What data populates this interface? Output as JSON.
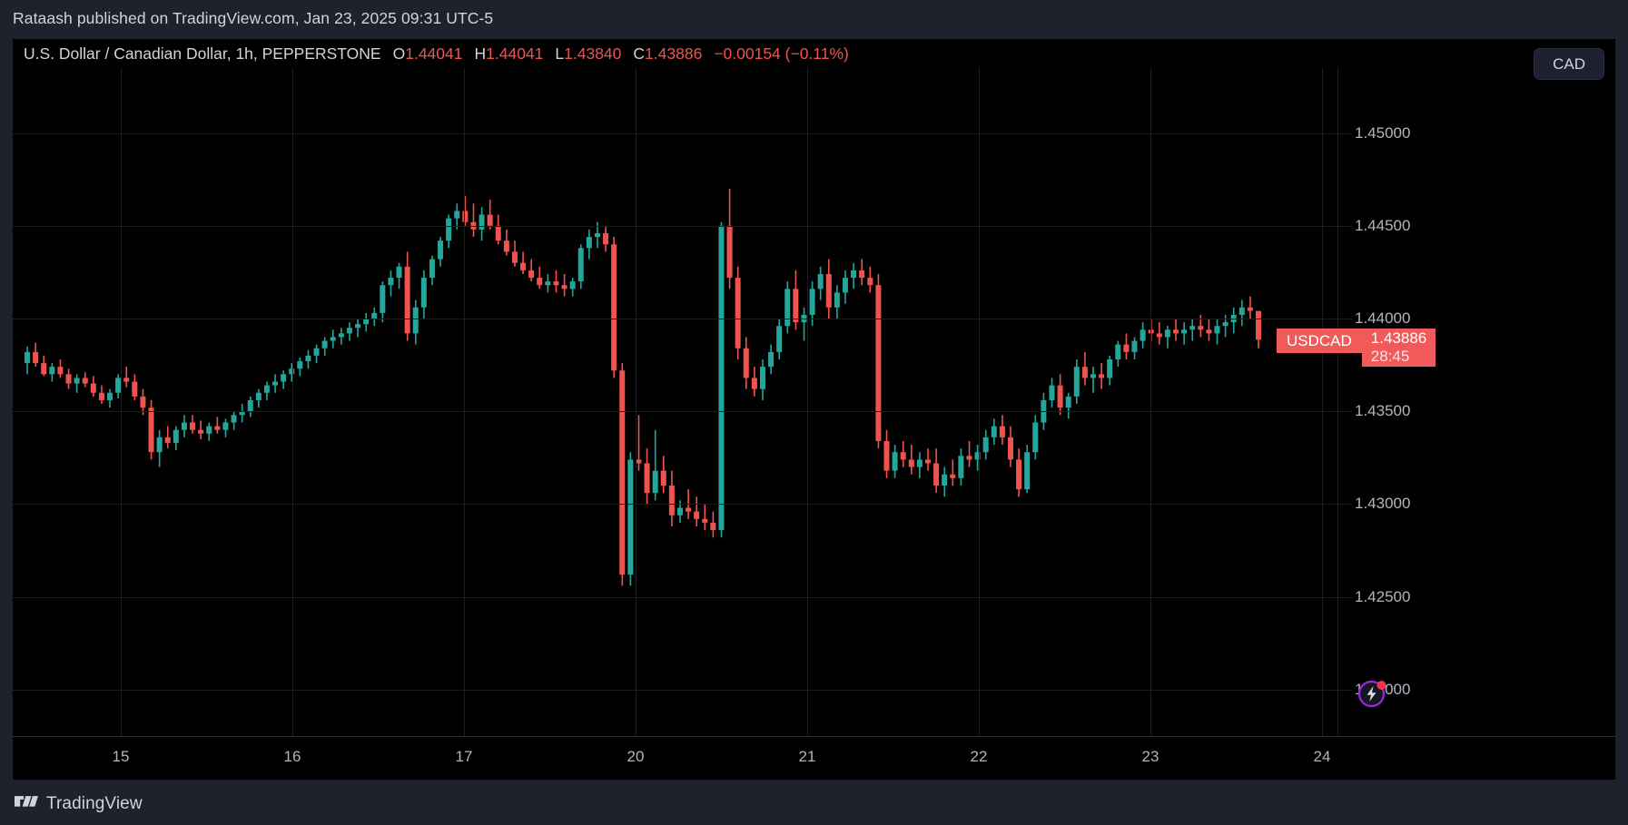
{
  "attribution": "Rataash published on TradingView.com, Jan 23, 2025 09:31 UTC-5",
  "legend": {
    "symbol_title": "U.S. Dollar / Canadian Dollar, 1h, PEPPERSTONE",
    "o_label": "O",
    "o_value": "1.44041",
    "h_label": "H",
    "h_value": "1.44041",
    "l_label": "L",
    "l_value": "1.43840",
    "c_label": "C",
    "c_value": "1.43886",
    "change": "−0.00154 (−0.11%)",
    "change_color": "#ef5350"
  },
  "currency_pill": {
    "label": "CAD"
  },
  "last_price_badge": {
    "symbol": "USDCAD",
    "price": "1.43886",
    "countdown": "28:45",
    "color": "#f05a5a"
  },
  "footer": {
    "brand": "TradingView"
  },
  "chart_data": {
    "type": "candlestick",
    "title": "U.S. Dollar / Canadian Dollar, 1h, PEPPERSTONE",
    "symbol": "USDCAD",
    "exchange": "PEPPERSTONE",
    "interval": "1h",
    "xlabel": "",
    "ylabel": "",
    "grid": true,
    "legend_position": "top-left",
    "up_color": "#26a69a",
    "down_color": "#ef5350",
    "background": "#000000",
    "ylim": [
      1.4175,
      1.4535
    ],
    "y_ticks": [
      "1.45000",
      "1.44500",
      "1.44000",
      "1.43500",
      "1.43000",
      "1.42500",
      "1.42000"
    ],
    "y_tick_values": [
      1.45,
      1.445,
      1.44,
      1.435,
      1.43,
      1.425,
      1.42
    ],
    "x_ticks": [
      "15",
      "16",
      "17",
      "20",
      "21",
      "22",
      "23",
      "24"
    ],
    "x_tick_positions": [
      119,
      308,
      497,
      686,
      875,
      1064,
      1253,
      1442
    ],
    "last_price": 1.43886,
    "open": 1.44041,
    "high": 1.44041,
    "low": 1.4384,
    "close": 1.43886,
    "change_abs": -0.00154,
    "change_pct": -0.11,
    "candles": [
      [
        1.4376,
        1.4385,
        1.437,
        1.4382
      ],
      [
        1.4382,
        1.4387,
        1.4374,
        1.4376
      ],
      [
        1.4376,
        1.438,
        1.4369,
        1.437
      ],
      [
        1.437,
        1.4376,
        1.4366,
        1.4374
      ],
      [
        1.4374,
        1.4378,
        1.4368,
        1.437
      ],
      [
        1.437,
        1.4373,
        1.4362,
        1.4365
      ],
      [
        1.4365,
        1.437,
        1.436,
        1.4368
      ],
      [
        1.4368,
        1.4371,
        1.4363,
        1.4365
      ],
      [
        1.4365,
        1.4369,
        1.4358,
        1.436
      ],
      [
        1.436,
        1.4364,
        1.4354,
        1.4356
      ],
      [
        1.4356,
        1.4362,
        1.4352,
        1.436
      ],
      [
        1.436,
        1.437,
        1.4357,
        1.4368
      ],
      [
        1.4368,
        1.4374,
        1.4363,
        1.4366
      ],
      [
        1.4366,
        1.437,
        1.4356,
        1.4358
      ],
      [
        1.4358,
        1.4362,
        1.4348,
        1.4352
      ],
      [
        1.4352,
        1.4356,
        1.4324,
        1.4328
      ],
      [
        1.4328,
        1.434,
        1.432,
        1.4336
      ],
      [
        1.4336,
        1.4342,
        1.433,
        1.4333
      ],
      [
        1.4333,
        1.4342,
        1.4329,
        1.434
      ],
      [
        1.434,
        1.4348,
        1.4336,
        1.4344
      ],
      [
        1.4344,
        1.4348,
        1.4338,
        1.434
      ],
      [
        1.434,
        1.4345,
        1.4335,
        1.4338
      ],
      [
        1.4338,
        1.4344,
        1.4334,
        1.4342
      ],
      [
        1.4342,
        1.4347,
        1.4338,
        1.434
      ],
      [
        1.434,
        1.4346,
        1.4336,
        1.4344
      ],
      [
        1.4344,
        1.435,
        1.434,
        1.4348
      ],
      [
        1.4348,
        1.4354,
        1.4344,
        1.435
      ],
      [
        1.435,
        1.4358,
        1.4347,
        1.4356
      ],
      [
        1.4356,
        1.4362,
        1.4352,
        1.436
      ],
      [
        1.436,
        1.4366,
        1.4356,
        1.4364
      ],
      [
        1.4364,
        1.437,
        1.436,
        1.4366
      ],
      [
        1.4366,
        1.4372,
        1.4362,
        1.437
      ],
      [
        1.437,
        1.4376,
        1.4366,
        1.4373
      ],
      [
        1.4373,
        1.4379,
        1.4369,
        1.4377
      ],
      [
        1.4377,
        1.4383,
        1.4373,
        1.438
      ],
      [
        1.438,
        1.4386,
        1.4376,
        1.4384
      ],
      [
        1.4384,
        1.439,
        1.438,
        1.4388
      ],
      [
        1.4388,
        1.4394,
        1.4384,
        1.439
      ],
      [
        1.439,
        1.4395,
        1.4386,
        1.4392
      ],
      [
        1.4392,
        1.4398,
        1.4388,
        1.4395
      ],
      [
        1.4395,
        1.44,
        1.439,
        1.4397
      ],
      [
        1.4397,
        1.4403,
        1.4393,
        1.44
      ],
      [
        1.44,
        1.4406,
        1.4396,
        1.4403
      ],
      [
        1.4403,
        1.442,
        1.4398,
        1.4418
      ],
      [
        1.4418,
        1.4426,
        1.4412,
        1.4422
      ],
      [
        1.4422,
        1.443,
        1.4416,
        1.4428
      ],
      [
        1.4428,
        1.4436,
        1.4388,
        1.4392
      ],
      [
        1.4392,
        1.441,
        1.4386,
        1.4406
      ],
      [
        1.4406,
        1.4426,
        1.44,
        1.4422
      ],
      [
        1.4422,
        1.4434,
        1.4418,
        1.4432
      ],
      [
        1.4432,
        1.4444,
        1.4428,
        1.4442
      ],
      [
        1.4442,
        1.4456,
        1.4438,
        1.4454
      ],
      [
        1.4454,
        1.4462,
        1.4448,
        1.4458
      ],
      [
        1.4458,
        1.4466,
        1.445,
        1.4452
      ],
      [
        1.4452,
        1.4462,
        1.4444,
        1.4448
      ],
      [
        1.4448,
        1.446,
        1.4442,
        1.4456
      ],
      [
        1.4456,
        1.4464,
        1.4448,
        1.445
      ],
      [
        1.445,
        1.4456,
        1.444,
        1.4442
      ],
      [
        1.4442,
        1.4448,
        1.4434,
        1.4436
      ],
      [
        1.4436,
        1.4442,
        1.4428,
        1.443
      ],
      [
        1.443,
        1.4436,
        1.4424,
        1.4426
      ],
      [
        1.4426,
        1.4432,
        1.442,
        1.4422
      ],
      [
        1.4422,
        1.4428,
        1.4416,
        1.4418
      ],
      [
        1.4418,
        1.4424,
        1.4414,
        1.442
      ],
      [
        1.442,
        1.4426,
        1.4414,
        1.4418
      ],
      [
        1.4418,
        1.4424,
        1.4412,
        1.4416
      ],
      [
        1.4416,
        1.4422,
        1.4412,
        1.442
      ],
      [
        1.442,
        1.444,
        1.4416,
        1.4438
      ],
      [
        1.4438,
        1.4448,
        1.4432,
        1.4444
      ],
      [
        1.4444,
        1.4452,
        1.4438,
        1.4446
      ],
      [
        1.4446,
        1.445,
        1.4436,
        1.444
      ],
      [
        1.444,
        1.4444,
        1.4368,
        1.4372
      ],
      [
        1.4372,
        1.4376,
        1.4256,
        1.4262
      ],
      [
        1.4262,
        1.4328,
        1.4256,
        1.4324
      ],
      [
        1.4324,
        1.4348,
        1.4318,
        1.4322
      ],
      [
        1.4322,
        1.433,
        1.43,
        1.4306
      ],
      [
        1.4306,
        1.434,
        1.4302,
        1.4318
      ],
      [
        1.4318,
        1.4326,
        1.4306,
        1.431
      ],
      [
        1.431,
        1.4318,
        1.4288,
        1.4294
      ],
      [
        1.4294,
        1.4302,
        1.429,
        1.4298
      ],
      [
        1.4298,
        1.4308,
        1.4292,
        1.4296
      ],
      [
        1.4296,
        1.4304,
        1.4288,
        1.4292
      ],
      [
        1.4292,
        1.43,
        1.4286,
        1.429
      ],
      [
        1.429,
        1.4296,
        1.4282,
        1.4286
      ],
      [
        1.4286,
        1.4452,
        1.4282,
        1.445
      ],
      [
        1.445,
        1.447,
        1.4416,
        1.4422
      ],
      [
        1.4422,
        1.4428,
        1.4378,
        1.4384
      ],
      [
        1.4384,
        1.439,
        1.4362,
        1.4368
      ],
      [
        1.4368,
        1.4374,
        1.4358,
        1.4362
      ],
      [
        1.4362,
        1.4378,
        1.4356,
        1.4374
      ],
      [
        1.4374,
        1.4386,
        1.437,
        1.4382
      ],
      [
        1.4382,
        1.44,
        1.4378,
        1.4396
      ],
      [
        1.4396,
        1.442,
        1.4392,
        1.4416
      ],
      [
        1.4416,
        1.4426,
        1.4394,
        1.4398
      ],
      [
        1.4398,
        1.4406,
        1.4388,
        1.4402
      ],
      [
        1.4402,
        1.442,
        1.4396,
        1.4416
      ],
      [
        1.4416,
        1.4428,
        1.441,
        1.4424
      ],
      [
        1.4424,
        1.4432,
        1.44,
        1.4406
      ],
      [
        1.4406,
        1.4418,
        1.44,
        1.4414
      ],
      [
        1.4414,
        1.4426,
        1.4408,
        1.4422
      ],
      [
        1.4422,
        1.443,
        1.4416,
        1.4426
      ],
      [
        1.4426,
        1.4432,
        1.4418,
        1.4422
      ],
      [
        1.4422,
        1.4428,
        1.4414,
        1.4418
      ],
      [
        1.4418,
        1.4424,
        1.433,
        1.4334
      ],
      [
        1.4334,
        1.434,
        1.4314,
        1.4318
      ],
      [
        1.4318,
        1.4332,
        1.4314,
        1.4328
      ],
      [
        1.4328,
        1.4334,
        1.432,
        1.4324
      ],
      [
        1.4324,
        1.4332,
        1.4316,
        1.432
      ],
      [
        1.432,
        1.4328,
        1.4314,
        1.4324
      ],
      [
        1.4324,
        1.433,
        1.4318,
        1.4322
      ],
      [
        1.4322,
        1.433,
        1.4306,
        1.431
      ],
      [
        1.431,
        1.432,
        1.4304,
        1.4316
      ],
      [
        1.4316,
        1.4324,
        1.431,
        1.4314
      ],
      [
        1.4314,
        1.433,
        1.431,
        1.4326
      ],
      [
        1.4326,
        1.4334,
        1.432,
        1.4324
      ],
      [
        1.4324,
        1.4332,
        1.4318,
        1.4328
      ],
      [
        1.4328,
        1.434,
        1.4324,
        1.4336
      ],
      [
        1.4336,
        1.4346,
        1.4332,
        1.4342
      ],
      [
        1.4342,
        1.4348,
        1.4332,
        1.4336
      ],
      [
        1.4336,
        1.4342,
        1.432,
        1.4324
      ],
      [
        1.4324,
        1.433,
        1.4304,
        1.4308
      ],
      [
        1.4308,
        1.4332,
        1.4306,
        1.4328
      ],
      [
        1.4328,
        1.4348,
        1.4324,
        1.4344
      ],
      [
        1.4344,
        1.436,
        1.434,
        1.4356
      ],
      [
        1.4356,
        1.4368,
        1.4352,
        1.4364
      ],
      [
        1.4364,
        1.437,
        1.4348,
        1.4352
      ],
      [
        1.4352,
        1.436,
        1.4346,
        1.4358
      ],
      [
        1.4358,
        1.4378,
        1.4354,
        1.4374
      ],
      [
        1.4374,
        1.4382,
        1.4364,
        1.4368
      ],
      [
        1.4368,
        1.4374,
        1.436,
        1.437
      ],
      [
        1.437,
        1.4376,
        1.4362,
        1.4368
      ],
      [
        1.4368,
        1.438,
        1.4364,
        1.4378
      ],
      [
        1.4378,
        1.4388,
        1.4374,
        1.4386
      ],
      [
        1.4386,
        1.4392,
        1.4378,
        1.4382
      ],
      [
        1.4382,
        1.439,
        1.4378,
        1.4388
      ],
      [
        1.4388,
        1.4398,
        1.4384,
        1.4394
      ],
      [
        1.4394,
        1.44,
        1.4388,
        1.4392
      ],
      [
        1.4392,
        1.4398,
        1.4386,
        1.439
      ],
      [
        1.439,
        1.4396,
        1.4384,
        1.4394
      ],
      [
        1.4394,
        1.44,
        1.4388,
        1.4392
      ],
      [
        1.4392,
        1.4398,
        1.4386,
        1.4394
      ],
      [
        1.4394,
        1.44,
        1.4388,
        1.4396
      ],
      [
        1.4396,
        1.4402,
        1.439,
        1.4394
      ],
      [
        1.4394,
        1.44,
        1.4388,
        1.4392
      ],
      [
        1.4392,
        1.44,
        1.4386,
        1.4396
      ],
      [
        1.4396,
        1.4402,
        1.439,
        1.4398
      ],
      [
        1.4398,
        1.4406,
        1.4392,
        1.4402
      ],
      [
        1.4402,
        1.441,
        1.4396,
        1.4406
      ],
      [
        1.4406,
        1.4412,
        1.44,
        1.44041
      ],
      [
        1.44041,
        1.44041,
        1.4384,
        1.43886
      ]
    ]
  }
}
